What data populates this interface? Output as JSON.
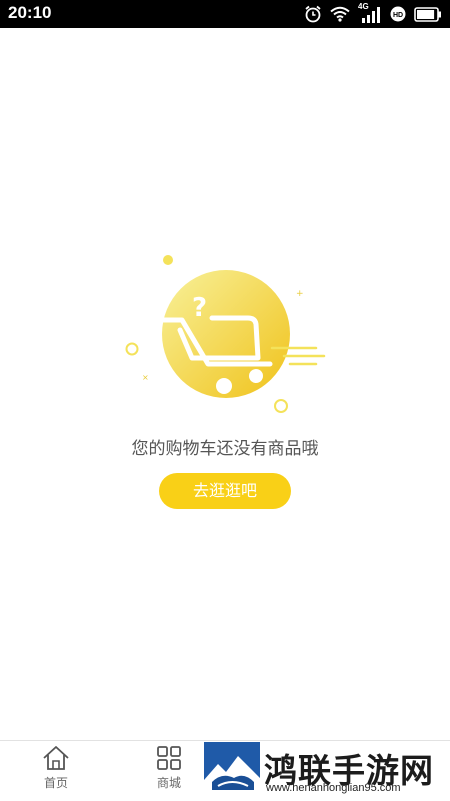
{
  "status_bar": {
    "time": "20:10",
    "network_label": "4G",
    "icons": [
      "alarm-icon",
      "wifi-icon",
      "cellular-signal-icon",
      "hd-icon",
      "battery-icon"
    ],
    "battery_level": 0.85
  },
  "empty_cart": {
    "message": "您的购物车还没有商品哦",
    "button_label": "去逛逛吧",
    "illustration_icon": "shopping-cart-question-icon",
    "colors": {
      "accent": "#f9d017",
      "circle_light": "#f7ee8a",
      "circle_dark": "#f2c81f"
    }
  },
  "tab_bar": {
    "items": [
      {
        "label": "首页",
        "icon": "home-icon"
      },
      {
        "label": "商城",
        "icon": "grid-icon"
      }
    ]
  },
  "watermark": {
    "title": "鸿联手游网",
    "url": "www.henanhonglian95.com"
  }
}
